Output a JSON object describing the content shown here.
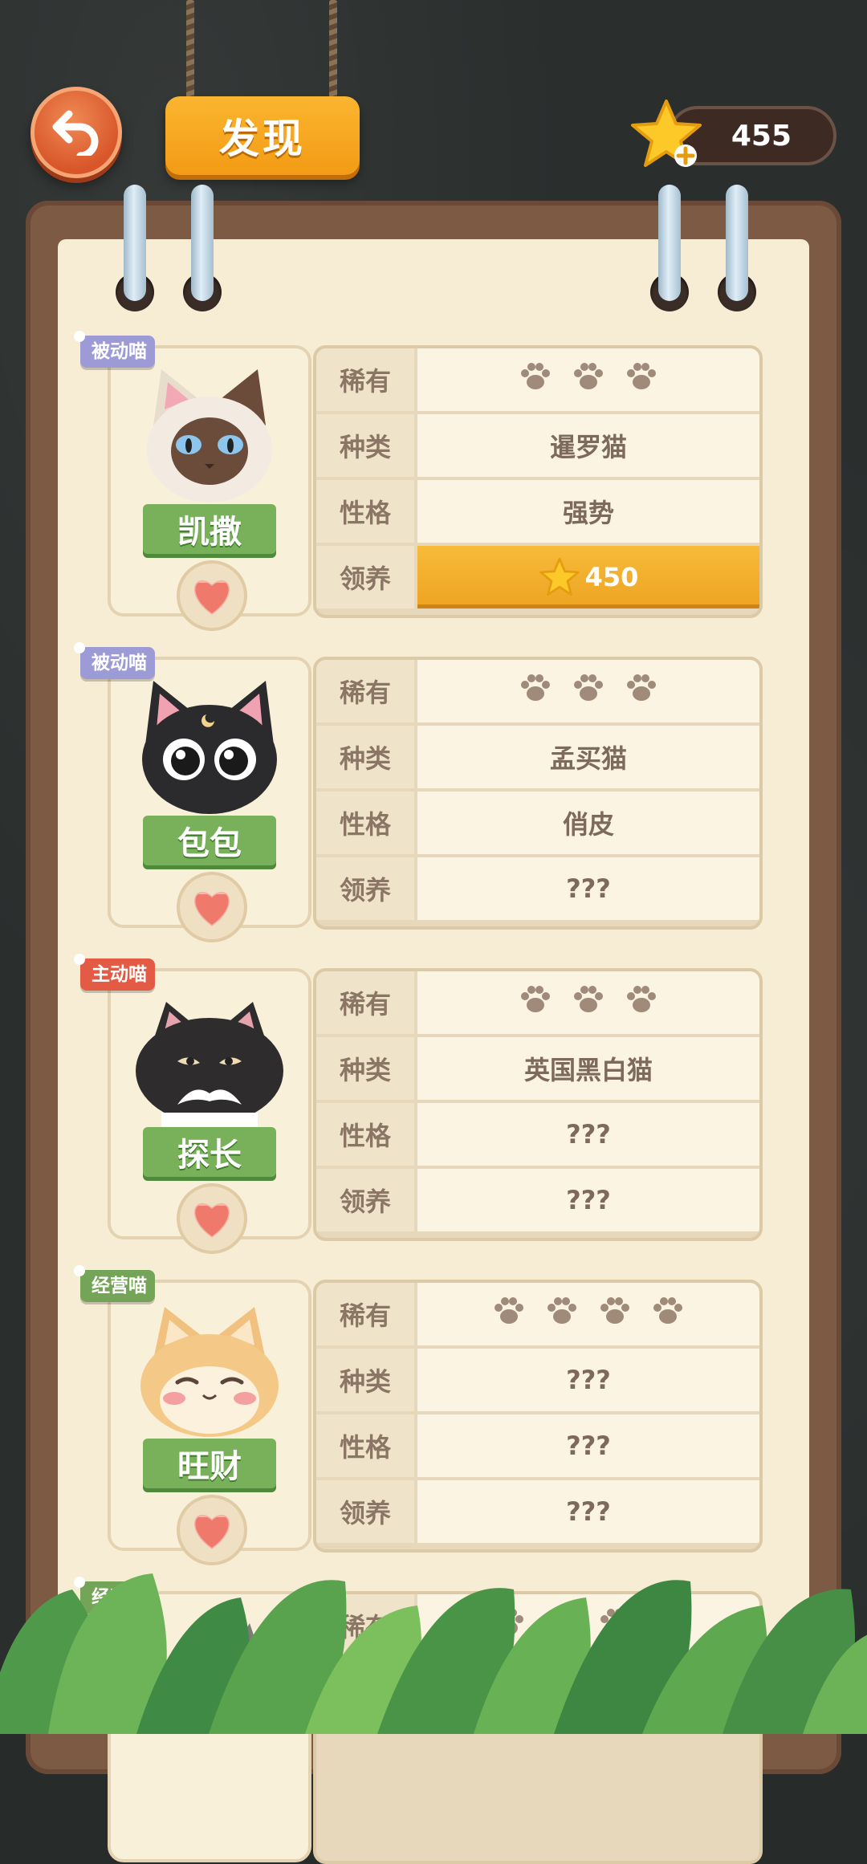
{
  "header": {
    "title": "发现",
    "currency": "455",
    "back_icon": "back-arrow-icon",
    "star_icon": "star-plus-icon"
  },
  "colors": {
    "accent_orange": "#f39b14",
    "back_button": "#d8562a",
    "tag_passive": "#9d9bd6",
    "tag_active": "#e35b45",
    "tag_business": "#73a457",
    "ribbon_green": "#78b159",
    "adopt_gold": "#eea322"
  },
  "labels": {
    "rarity": "稀有",
    "breed": "种类",
    "personality": "性格",
    "adopt": "领养"
  },
  "cats": [
    {
      "tag": "被动喵",
      "tag_type": "passive",
      "name": "凯撒",
      "paws": 3,
      "breed": "暹罗猫",
      "personality": "强势",
      "adopt": "450",
      "adopt_is_price": true,
      "affection": 1.0
    },
    {
      "tag": "被动喵",
      "tag_type": "passive",
      "name": "包包",
      "paws": 3,
      "breed": "孟买猫",
      "personality": "俏皮",
      "adopt": "???",
      "adopt_is_price": false,
      "affection": 0.55
    },
    {
      "tag": "主动喵",
      "tag_type": "active",
      "name": "探长",
      "paws": 3,
      "breed": "英国黑白猫",
      "personality": "???",
      "adopt": "???",
      "adopt_is_price": false,
      "affection": 0.35
    },
    {
      "tag": "经营喵",
      "tag_type": "business",
      "name": "旺财",
      "paws": 4,
      "breed": "???",
      "personality": "???",
      "adopt": "???",
      "adopt_is_price": false,
      "affection": 0.1
    },
    {
      "tag": "经营喵",
      "tag_type": "business",
      "name": "",
      "paws": 4,
      "breed": "",
      "personality": "",
      "adopt": "",
      "adopt_is_price": false,
      "affection": 0
    }
  ],
  "partial_card": {
    "tag": "经营喵",
    "first_label": "稀有"
  }
}
